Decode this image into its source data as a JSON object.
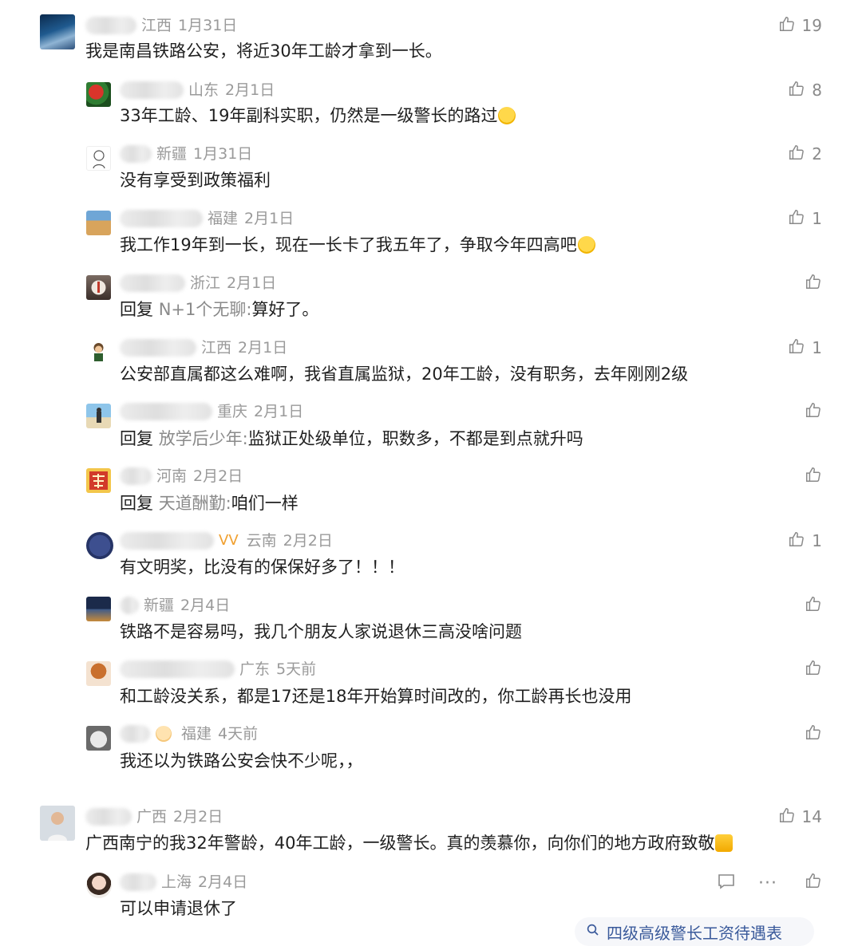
{
  "comments": [
    {
      "level": "top",
      "avatar_icon": "night-sky-avatar",
      "location": "江西",
      "date": "1月31日",
      "text": "我是南昌铁路公安，将近30年工龄才拿到一长。",
      "likes": "19"
    },
    {
      "level": "reply",
      "avatar_icon": "watermelon-avatar",
      "location": "山东",
      "date": "2月1日",
      "text": "33年工龄、19年副科实职，仍然是一级警长的路过",
      "likes": "8",
      "emoji": "crying-laugh-emoji"
    },
    {
      "level": "reply",
      "avatar_icon": "cartoon-sketch-avatar",
      "location": "新疆",
      "date": "1月31日",
      "text": "没有享受到政策福利",
      "likes": "2"
    },
    {
      "level": "reply",
      "avatar_icon": "camel-desert-avatar",
      "location": "福建",
      "date": "2月1日",
      "text": "我工作19年到一长，现在一长卡了我五年了，争取今年四高吧",
      "likes": "1",
      "emoji": "thinking-emoji"
    },
    {
      "level": "reply",
      "avatar_icon": "lighthouse-avatar",
      "location": "浙江",
      "date": "2月1日",
      "reply_word": "回复",
      "reply_to": "N+1个无聊:",
      "text": "算好了。",
      "likes": ""
    },
    {
      "level": "reply",
      "avatar_icon": "cartoon-boy-avatar",
      "location": "江西",
      "date": "2月1日",
      "text": "公安部直属都这么难啊，我省直属监狱，20年工龄，没有职务，去年刚刚2级",
      "likes": "1"
    },
    {
      "level": "reply",
      "avatar_icon": "beach-person-avatar",
      "location": "重庆",
      "date": "2月1日",
      "reply_word": "回复",
      "reply_to": "放学后少年:",
      "text": "监狱正处级单位，职数多，不都是到点就升吗",
      "likes": ""
    },
    {
      "level": "reply",
      "avatar_icon": "red-calligraphy-avatar",
      "location": "河南",
      "date": "2月2日",
      "reply_word": "回复",
      "reply_to": "天道酬勤:",
      "text": "咱们一样",
      "likes": ""
    },
    {
      "level": "reply",
      "avatar_icon": "blue-circle-avatar",
      "location": "云南",
      "date": "2月2日",
      "badge": "vip-badge-icon",
      "text": "有文明奖，比没有的保保好多了！！！",
      "likes": "1"
    },
    {
      "level": "reply",
      "avatar_icon": "city-night-avatar",
      "location": "新疆",
      "date": "2月4日",
      "text": "铁路不是容易吗，我几个朋友人家说退休三高没啥问题",
      "likes": ""
    },
    {
      "level": "reply",
      "avatar_icon": "food-photo-avatar",
      "location": "广东",
      "date": "5天前",
      "text": "和工龄没关系，都是17还是18年开始算时间改的，你工龄再长也没用",
      "likes": ""
    },
    {
      "level": "reply",
      "avatar_icon": "cat-avatar",
      "location": "福建",
      "date": "4天前",
      "text": "我还以为铁路公安会快不少呢，，",
      "likes": "",
      "name_emoji": "smile-emoji"
    },
    {
      "level": "top",
      "avatar_icon": "man-portrait-avatar",
      "location": "广西",
      "date": "2月2日",
      "text": "广西南宁的我32年警龄，40年工龄，一级警长。真的羡慕你，向你们的地方政府致敬",
      "likes": "14",
      "emoji": "thumbs-up-emoji"
    },
    {
      "level": "reply",
      "avatar_icon": "woman-portrait-avatar",
      "location": "上海",
      "date": "2月4日",
      "text": "可以申请退休了",
      "likes": "",
      "show_actions": true
    }
  ],
  "search_hint": {
    "text": "四级高级警长工资待遇表",
    "icon": "search-icon"
  },
  "colors": {
    "meta": "#9a9a9a",
    "reply_name": "#8a8a8a",
    "link": "#3a5a9b"
  }
}
